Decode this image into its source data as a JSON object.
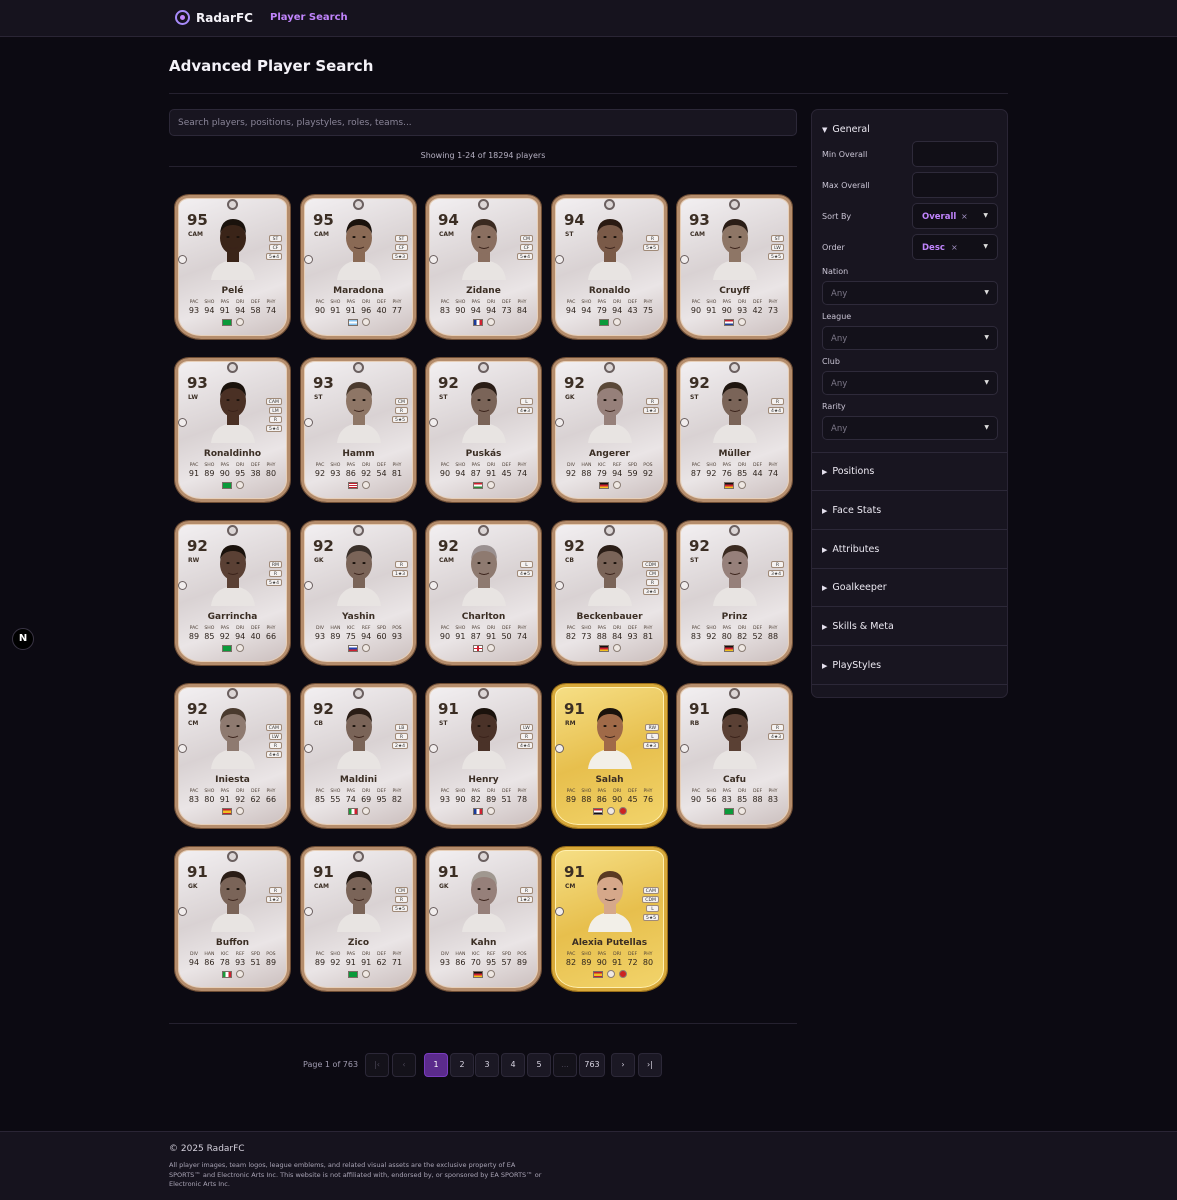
{
  "nav": {
    "brand": "RadarFC",
    "link": "Player Search"
  },
  "page_title": "Advanced Player Search",
  "search": {
    "placeholder": "Search players, positions, playstyles, roles, teams..."
  },
  "results_text": "Showing 1-24 of 18294 players",
  "cards": [
    {
      "name": "Pelé",
      "ovr": "95",
      "pos": "CAM",
      "gold": false,
      "alt": [
        "ST",
        "CF",
        "5★4"
      ],
      "labels": [
        "PAC",
        "SHO",
        "PAS",
        "DRI",
        "DEF",
        "PHY"
      ],
      "stats": [
        "93",
        "94",
        "91",
        "94",
        "58",
        "74"
      ],
      "nation": "brazil",
      "skin": "#3a2418",
      "hair": "#1a120c"
    },
    {
      "name": "Maradona",
      "ovr": "95",
      "pos": "CAM",
      "gold": false,
      "alt": [
        "ST",
        "CF",
        "5★3"
      ],
      "labels": [
        "PAC",
        "SHO",
        "PAS",
        "DRI",
        "DEF",
        "PHY"
      ],
      "stats": [
        "90",
        "91",
        "91",
        "96",
        "40",
        "77"
      ],
      "nation": "argentina",
      "skin": "#8a6a55",
      "hair": "#1a120c"
    },
    {
      "name": "Zidane",
      "ovr": "94",
      "pos": "CAM",
      "gold": false,
      "alt": [
        "CM",
        "CF",
        "5★4"
      ],
      "labels": [
        "PAC",
        "SHO",
        "PAS",
        "DRI",
        "DEF",
        "PHY"
      ],
      "stats": [
        "83",
        "90",
        "94",
        "94",
        "73",
        "84"
      ],
      "nation": "france",
      "skin": "#8a6f60",
      "hair": "#3a2a20"
    },
    {
      "name": "Ronaldo",
      "ovr": "94",
      "pos": "ST",
      "gold": false,
      "alt": [
        "R",
        "5★5"
      ],
      "labels": [
        "PAC",
        "SHO",
        "PAS",
        "DRI",
        "DEF",
        "PHY"
      ],
      "stats": [
        "94",
        "94",
        "79",
        "94",
        "43",
        "75"
      ],
      "nation": "brazil",
      "skin": "#7a5a48",
      "hair": "#2a1a12"
    },
    {
      "name": "Cruyff",
      "ovr": "93",
      "pos": "CAM",
      "gold": false,
      "alt": [
        "ST",
        "LW",
        "5★5"
      ],
      "labels": [
        "PAC",
        "SHO",
        "PAS",
        "DRI",
        "DEF",
        "PHY"
      ],
      "stats": [
        "90",
        "91",
        "90",
        "93",
        "42",
        "73"
      ],
      "nation": "netherlands",
      "skin": "#8e7666",
      "hair": "#2a1d16"
    },
    {
      "name": "Ronaldinho",
      "ovr": "93",
      "pos": "LW",
      "gold": false,
      "alt": [
        "CAM",
        "LM",
        "R",
        "5★4"
      ],
      "labels": [
        "PAC",
        "SHO",
        "PAS",
        "DRI",
        "DEF",
        "PHY"
      ],
      "stats": [
        "91",
        "89",
        "90",
        "95",
        "38",
        "80"
      ],
      "nation": "brazil",
      "skin": "#4a3024",
      "hair": "#1a120c"
    },
    {
      "name": "Hamm",
      "ovr": "93",
      "pos": "ST",
      "gold": false,
      "alt": [
        "CM",
        "R",
        "5★5"
      ],
      "labels": [
        "PAC",
        "SHO",
        "PAS",
        "DRI",
        "DEF",
        "PHY"
      ],
      "stats": [
        "92",
        "93",
        "86",
        "92",
        "54",
        "81"
      ],
      "nation": "usa",
      "skin": "#8e7666",
      "hair": "#4a3a2e"
    },
    {
      "name": "Puskás",
      "ovr": "92",
      "pos": "ST",
      "gold": false,
      "alt": [
        "L",
        "4★3"
      ],
      "labels": [
        "PAC",
        "SHO",
        "PAS",
        "DRI",
        "DEF",
        "PHY"
      ],
      "stats": [
        "90",
        "94",
        "87",
        "91",
        "45",
        "74"
      ],
      "nation": "hungary",
      "skin": "#7a6458",
      "hair": "#2a1d16"
    },
    {
      "name": "Angerer",
      "ovr": "92",
      "pos": "GK",
      "gold": false,
      "alt": [
        "R",
        "1★3"
      ],
      "labels": [
        "DIV",
        "HAN",
        "KIC",
        "REF",
        "SPD",
        "POS"
      ],
      "stats": [
        "92",
        "88",
        "79",
        "94",
        "59",
        "92"
      ],
      "nation": "germany",
      "skin": "#96807a",
      "hair": "#5a4838"
    },
    {
      "name": "Müller",
      "ovr": "92",
      "pos": "ST",
      "gold": false,
      "alt": [
        "R",
        "4★4"
      ],
      "labels": [
        "PAC",
        "SHO",
        "PAS",
        "DRI",
        "DEF",
        "PHY"
      ],
      "stats": [
        "87",
        "92",
        "76",
        "85",
        "44",
        "74"
      ],
      "nation": "germany",
      "skin": "#7a6458",
      "hair": "#1f1610"
    },
    {
      "name": "Garrincha",
      "ovr": "92",
      "pos": "RW",
      "gold": false,
      "alt": [
        "RM",
        "R",
        "5★4"
      ],
      "labels": [
        "PAC",
        "SHO",
        "PAS",
        "DRI",
        "DEF",
        "PHY"
      ],
      "stats": [
        "89",
        "85",
        "92",
        "94",
        "40",
        "66"
      ],
      "nation": "brazil",
      "skin": "#5a4034",
      "hair": "#1a120c"
    },
    {
      "name": "Yashin",
      "ovr": "92",
      "pos": "GK",
      "gold": false,
      "alt": [
        "R",
        "1★3"
      ],
      "labels": [
        "DIV",
        "HAN",
        "KIC",
        "REF",
        "SPD",
        "POS"
      ],
      "stats": [
        "93",
        "89",
        "75",
        "94",
        "60",
        "93"
      ],
      "nation": "russia",
      "skin": "#7a6458",
      "hair": "#3a302a"
    },
    {
      "name": "Charlton",
      "ovr": "92",
      "pos": "CAM",
      "gold": false,
      "alt": [
        "L",
        "4★5"
      ],
      "labels": [
        "PAC",
        "SHO",
        "PAS",
        "DRI",
        "DEF",
        "PHY"
      ],
      "stats": [
        "90",
        "91",
        "87",
        "91",
        "50",
        "74"
      ],
      "nation": "england",
      "skin": "#8e7a70",
      "hair": "#9a9090"
    },
    {
      "name": "Beckenbauer",
      "ovr": "92",
      "pos": "CB",
      "gold": false,
      "alt": [
        "CDM",
        "CM",
        "R",
        "3★4"
      ],
      "labels": [
        "PAC",
        "SHO",
        "PAS",
        "DRI",
        "DEF",
        "PHY"
      ],
      "stats": [
        "82",
        "73",
        "88",
        "84",
        "93",
        "81"
      ],
      "nation": "germany",
      "skin": "#7a6458",
      "hair": "#2a1d16"
    },
    {
      "name": "Prinz",
      "ovr": "92",
      "pos": "ST",
      "gold": false,
      "alt": [
        "R",
        "3★4"
      ],
      "labels": [
        "PAC",
        "SHO",
        "PAS",
        "DRI",
        "DEF",
        "PHY"
      ],
      "stats": [
        "83",
        "92",
        "80",
        "82",
        "52",
        "88"
      ],
      "nation": "germany",
      "skin": "#96807a",
      "hair": "#3a2a20"
    },
    {
      "name": "Iniesta",
      "ovr": "92",
      "pos": "CM",
      "gold": false,
      "alt": [
        "CAM",
        "LW",
        "R",
        "4★4"
      ],
      "labels": [
        "PAC",
        "SHO",
        "PAS",
        "DRI",
        "DEF",
        "PHY"
      ],
      "stats": [
        "83",
        "80",
        "91",
        "92",
        "62",
        "66"
      ],
      "nation": "spain",
      "skin": "#8e7a70",
      "hair": "#4a3a2e"
    },
    {
      "name": "Maldini",
      "ovr": "92",
      "pos": "CB",
      "gold": false,
      "alt": [
        "LB",
        "R",
        "2★4"
      ],
      "labels": [
        "PAC",
        "SHO",
        "PAS",
        "DRI",
        "DEF",
        "PHY"
      ],
      "stats": [
        "85",
        "55",
        "74",
        "69",
        "95",
        "82"
      ],
      "nation": "italy",
      "skin": "#7a6458",
      "hair": "#2a1d16"
    },
    {
      "name": "Henry",
      "ovr": "91",
      "pos": "ST",
      "gold": false,
      "alt": [
        "LW",
        "R",
        "4★4"
      ],
      "labels": [
        "PAC",
        "SHO",
        "PAS",
        "DRI",
        "DEF",
        "PHY"
      ],
      "stats": [
        "93",
        "90",
        "82",
        "89",
        "51",
        "78"
      ],
      "nation": "france",
      "skin": "#4a3228",
      "hair": "#1a120c"
    },
    {
      "name": "Salah",
      "ovr": "91",
      "pos": "RM",
      "gold": true,
      "alt": [
        "RW",
        "L",
        "4★3"
      ],
      "labels": [
        "PAC",
        "SHO",
        "PAS",
        "DRI",
        "DEF",
        "PHY"
      ],
      "stats": [
        "89",
        "88",
        "86",
        "90",
        "45",
        "76"
      ],
      "nation": "egypt",
      "skin": "#a06a48",
      "hair": "#1a120c"
    },
    {
      "name": "Cafu",
      "ovr": "91",
      "pos": "RB",
      "gold": false,
      "alt": [
        "R",
        "4★3"
      ],
      "labels": [
        "PAC",
        "SHO",
        "PAS",
        "DRI",
        "DEF",
        "PHY"
      ],
      "stats": [
        "90",
        "56",
        "83",
        "85",
        "88",
        "83"
      ],
      "nation": "brazil",
      "skin": "#5a4034",
      "hair": "#1a120c"
    },
    {
      "name": "Buffon",
      "ovr": "91",
      "pos": "GK",
      "gold": false,
      "alt": [
        "R",
        "1★2"
      ],
      "labels": [
        "DIV",
        "HAN",
        "KIC",
        "REF",
        "SPD",
        "POS"
      ],
      "stats": [
        "94",
        "86",
        "78",
        "93",
        "51",
        "89"
      ],
      "nation": "italy",
      "skin": "#7a6458",
      "hair": "#2a1d16"
    },
    {
      "name": "Zico",
      "ovr": "91",
      "pos": "CAM",
      "gold": false,
      "alt": [
        "CM",
        "R",
        "5★5"
      ],
      "labels": [
        "PAC",
        "SHO",
        "PAS",
        "DRI",
        "DEF",
        "PHY"
      ],
      "stats": [
        "89",
        "92",
        "91",
        "91",
        "62",
        "71"
      ],
      "nation": "brazil",
      "skin": "#7a6458",
      "hair": "#1f1610"
    },
    {
      "name": "Kahn",
      "ovr": "91",
      "pos": "GK",
      "gold": false,
      "alt": [
        "R",
        "1★2"
      ],
      "labels": [
        "DIV",
        "HAN",
        "KIC",
        "REF",
        "SPD",
        "POS"
      ],
      "stats": [
        "93",
        "86",
        "70",
        "95",
        "57",
        "89"
      ],
      "nation": "germany",
      "skin": "#96807a",
      "hair": "#a09890"
    },
    {
      "name": "Alexia Putellas",
      "ovr": "91",
      "pos": "CM",
      "gold": true,
      "alt": [
        "CAM",
        "CDM",
        "L",
        "5★5"
      ],
      "labels": [
        "PAC",
        "SHO",
        "PAS",
        "DRI",
        "DEF",
        "PHY"
      ],
      "stats": [
        "82",
        "89",
        "90",
        "91",
        "72",
        "80"
      ],
      "nation": "spain",
      "skin": "#d6a88a",
      "hair": "#5a3a22"
    }
  ],
  "pagination": {
    "info": "Page 1 of 763",
    "first": "|‹",
    "prev": "‹",
    "pages": [
      "1",
      "2",
      "3",
      "4",
      "5",
      "...",
      "763"
    ],
    "next": "›",
    "last": "›|"
  },
  "sidebar": {
    "general": "General",
    "min_overall": "Min Overall",
    "max_overall": "Max Overall",
    "sort_by": "Sort By",
    "sort_value": "Overall",
    "order": "Order",
    "order_value": "Desc",
    "clear": "×",
    "nation": "Nation",
    "league": "League",
    "club": "Club",
    "rarity": "Rarity",
    "any": "Any",
    "sections": [
      "Positions",
      "Face Stats",
      "Attributes",
      "Goalkeeper",
      "Skills & Meta",
      "PlayStyles"
    ]
  },
  "badge": "N",
  "footer": {
    "copy": "© 2025 RadarFC",
    "legal": "All player images, team logos, league emblems, and related visual assets are the exclusive property of EA SPORTS™ and Electronic Arts Inc. This website is not affiliated with, endorsed by, or sponsored by EA SPORTS™ or Electronic Arts Inc."
  },
  "colors": {
    "accent": "#c084fc",
    "active_page": "#5b2b8c",
    "background": "#0c0a12"
  }
}
